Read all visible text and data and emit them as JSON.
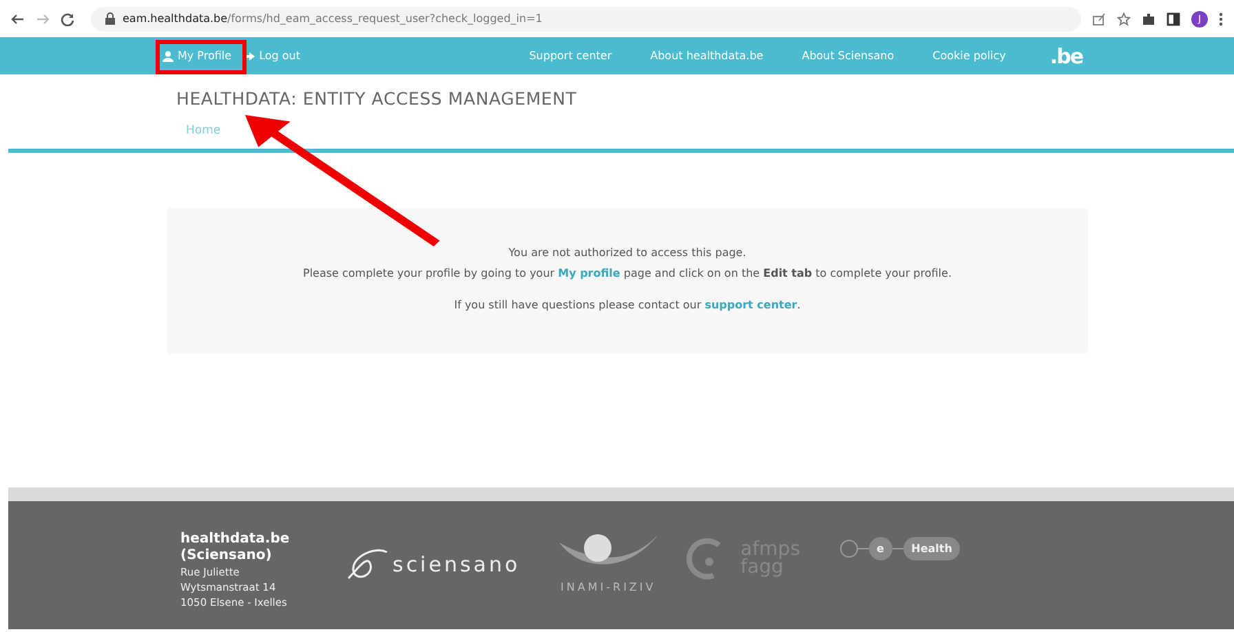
{
  "browser": {
    "url_host": "eam.healthdata.be",
    "url_path": "/forms/hd_eam_access_request_user?check_logged_in=1",
    "avatar": "J"
  },
  "nav": {
    "left": [
      {
        "label": "My Profile",
        "kind": "profile"
      },
      {
        "label": "Log out",
        "kind": "logout"
      }
    ],
    "right": [
      "Support center",
      "About healthdata.be",
      "About Sciensano",
      "Cookie policy"
    ],
    "logo": ".be"
  },
  "header": {
    "title": "HEALTHDATA: ENTITY ACCESS MANAGEMENT",
    "breadcrumb": "Home"
  },
  "message": {
    "lines": [
      "You are not authorized to access this page."
    ],
    "profile_line": {
      "before": "Please complete your profile by going to your",
      "link": "My profile",
      "middle": "page and click on on the **Edit tab** to complete your profile."
    },
    "support_line": {
      "before": "If you still have questions please contact our",
      "link": "support center",
      "after": "."
    }
  },
  "footer": {
    "org": "healthdata.be (Sciensano)",
    "address": [
      "Rue Juliette",
      "Wytsmanstraat 14",
      "1050 Elsene - Ixelles"
    ],
    "logos": [
      {
        "kind": "sciensano",
        "text": "sciensano"
      },
      {
        "kind": "inami",
        "text": "INAMI-RIZIV"
      },
      {
        "kind": "afmps",
        "text": "afmps fagg"
      },
      {
        "kind": "ehealth",
        "text": "e",
        "text2": "Health"
      }
    ]
  }
}
